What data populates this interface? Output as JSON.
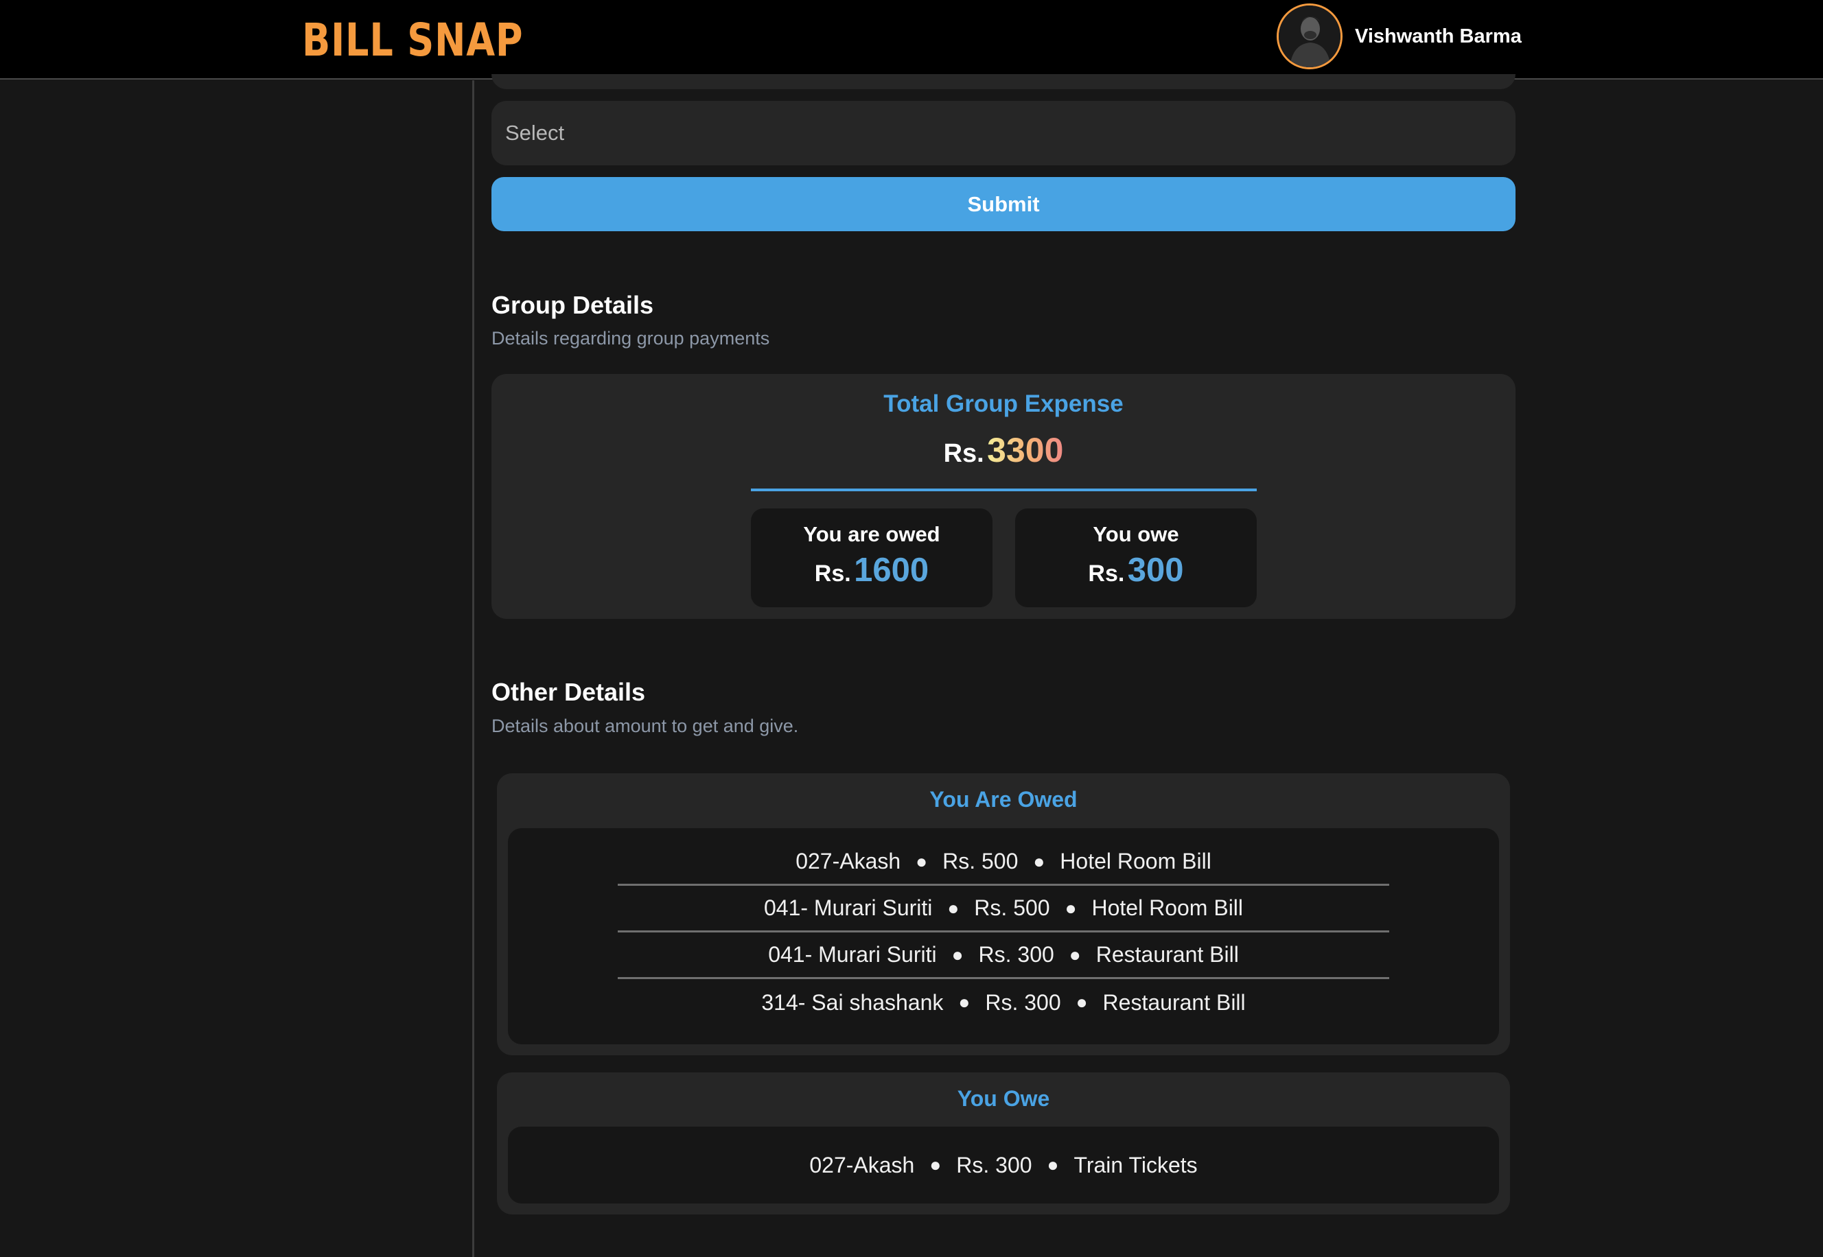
{
  "header": {
    "logo": "BILL SNAP",
    "user_name": "Vishwanth Barma"
  },
  "form": {
    "select_placeholder": "Select",
    "submit_label": "Submit"
  },
  "group_details": {
    "title": "Group Details",
    "subtitle": "Details regarding group payments",
    "total_label": "Total Group Expense",
    "currency": "Rs.",
    "total_value": "3300",
    "owed_label": "You are owed",
    "owed_value": "1600",
    "owe_label": "You owe",
    "owe_value": "300"
  },
  "other_details": {
    "title": "Other Details",
    "subtitle": "Details about amount to get and give.",
    "you_are_owed": {
      "title": "You Are Owed",
      "entries": [
        {
          "person": "027-Akash",
          "amount": "Rs. 500",
          "bill": "Hotel Room Bill"
        },
        {
          "person": "041- Murari Suriti",
          "amount": "Rs. 500",
          "bill": "Hotel Room Bill"
        },
        {
          "person": "041- Murari Suriti",
          "amount": "Rs. 300",
          "bill": "Restaurant Bill"
        },
        {
          "person": "314- Sai shashank",
          "amount": "Rs. 300",
          "bill": "Restaurant Bill"
        }
      ]
    },
    "you_owe": {
      "title": "You Owe",
      "entries": [
        {
          "person": "027-Akash",
          "amount": "Rs. 300",
          "bill": "Train Tickets"
        }
      ]
    }
  },
  "colors": {
    "accent_orange": "#f59a3e",
    "accent_blue": "#4aa3e4",
    "button_blue": "#48a3e3",
    "background": "#171717",
    "card": "#262626"
  }
}
